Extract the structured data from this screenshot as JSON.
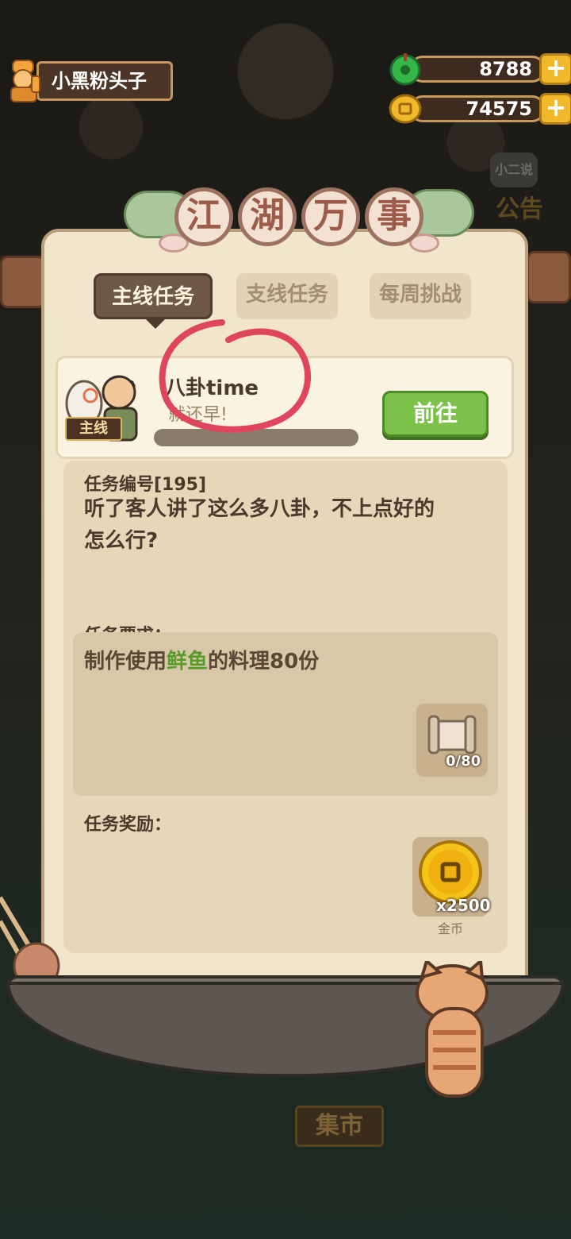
{
  "player": {
    "name": "小黑粉头子"
  },
  "currency": {
    "jade": "8788",
    "coins": "74575",
    "plus": "+"
  },
  "background": {
    "market_sign": "集市",
    "notice": "公告",
    "notice_bubble": "小二说"
  },
  "panel": {
    "title_chars": [
      "江",
      "湖",
      "万",
      "事"
    ],
    "tabs": [
      {
        "label": "主线任务",
        "active": true
      },
      {
        "label": "支线任务",
        "active": false
      },
      {
        "label": "每周挑战",
        "active": false
      }
    ]
  },
  "quest": {
    "badge": "主线",
    "title": "八卦time",
    "subtitle": "就还早!",
    "go_button": "前往",
    "number_label": "任务编号[195]",
    "description_line1": "听了客人讲了这么多八卦，不上点好的",
    "description_line2": "怎么行?",
    "requirement_label": "任务要求：",
    "requirement_pre": "制作使用",
    "requirement_highlight": "鲜鱼",
    "requirement_post": "的料理80份",
    "requirement_progress": "0/80",
    "reward_label": "任务奖励：",
    "reward_amount": "x2500",
    "reward_name": "金币"
  },
  "colors": {
    "accent_green": "#7cc14a",
    "highlight_green": "#5a9a2c",
    "panel_bg": "#f1e5cc",
    "circle_mark": "#e0455e"
  },
  "icons": {
    "player_avatar": "chef-icon",
    "jade": "jade-icon",
    "coin": "coin-icon",
    "requirement_item": "scroll-icon",
    "reward_item": "gold-coin-icon"
  }
}
